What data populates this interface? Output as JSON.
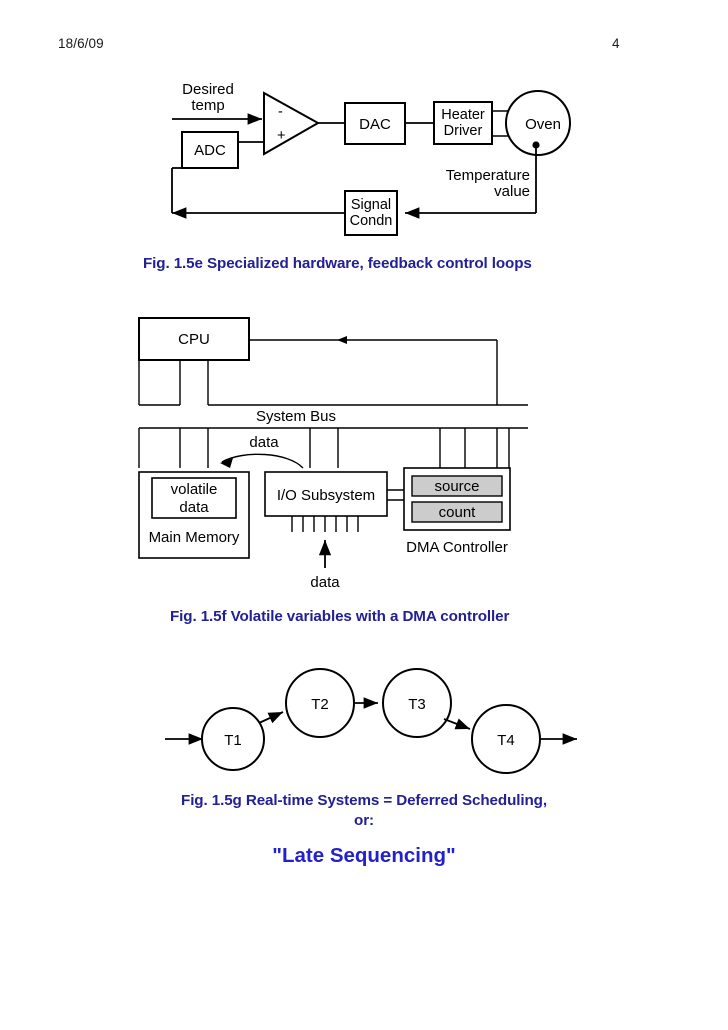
{
  "header": {
    "date": "18/6/09",
    "page_number": "4"
  },
  "figures": [
    {
      "id": "fig-1-5e",
      "caption": "Fig. 1.5e  Specialized hardware, feedback control loops",
      "caption_color": "#222093",
      "labels": {
        "desired_temp_line1": "Desired",
        "desired_temp_line2": "temp",
        "comparator_minus": "-",
        "comparator_plus": "+",
        "adc": "ADC",
        "dac": "DAC",
        "heater_driver_line1": "Heater",
        "heater_driver_line2": "Driver",
        "oven": "Oven",
        "temperature_value_line1": "Temperature",
        "temperature_value_line2": "value",
        "signal_condn_line1": "Signal",
        "signal_condn_line2": "Condn"
      }
    },
    {
      "id": "fig-1-5f",
      "caption": "Fig. 1.5f  Volatile variables with a DMA controller",
      "caption_color": "#222093",
      "labels": {
        "cpu": "CPU",
        "system_bus": "System Bus",
        "data_bus_transfer": "data",
        "volatile_line1": "volatile",
        "volatile_line2": "data",
        "main_memory": "Main Memory",
        "io_subsystem": "I/O Subsystem",
        "source_register": "source",
        "count_register": "count",
        "dma_controller": "DMA Controller",
        "data_input": "data"
      }
    },
    {
      "id": "fig-1-5g",
      "caption_line1": "Fig. 1.5g  Real-time Systems = Deferred Scheduling,",
      "caption_line2": "or:",
      "caption_color": "#222093",
      "emphasis": "\"Late Sequencing\"",
      "emphasis_color": "#2222cc",
      "tasks": [
        "T1",
        "T2",
        "T3",
        "T4"
      ]
    }
  ]
}
